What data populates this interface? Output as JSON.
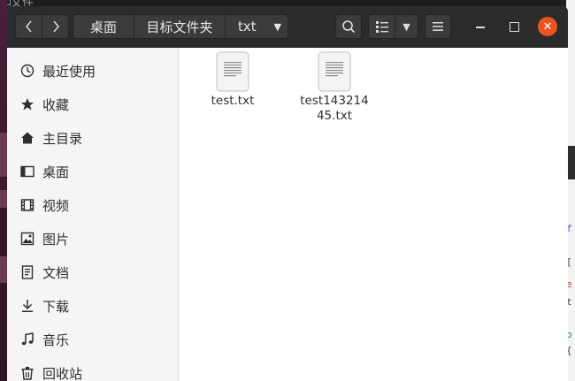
{
  "background": {
    "window_title": "文件"
  },
  "toolbar": {
    "back_icon": "chevron-left-icon",
    "forward_icon": "chevron-right-icon",
    "breadcrumbs": [
      "桌面",
      "目标文件夹",
      "txt"
    ],
    "search_icon": "search-icon",
    "view_icon": "list-view-icon",
    "menu_icon": "hamburger-menu-icon"
  },
  "window_controls": {
    "close_color": "#e95420"
  },
  "sidebar": {
    "items": [
      {
        "label": "最近使用",
        "icon": "clock-icon"
      },
      {
        "label": "收藏",
        "icon": "star-icon"
      },
      {
        "label": "主目录",
        "icon": "home-icon"
      },
      {
        "label": "桌面",
        "icon": "desktop-icon"
      },
      {
        "label": "视频",
        "icon": "video-icon"
      },
      {
        "label": "图片",
        "icon": "image-icon"
      },
      {
        "label": "文档",
        "icon": "document-icon"
      },
      {
        "label": "下载",
        "icon": "download-icon"
      },
      {
        "label": "音乐",
        "icon": "music-icon"
      },
      {
        "label": "回收站",
        "icon": "trash-icon"
      }
    ]
  },
  "files": [
    {
      "name": "test.txt",
      "icon": "text-file-icon"
    },
    {
      "name": "test14321445.txt",
      "icon": "text-file-icon"
    }
  ]
}
